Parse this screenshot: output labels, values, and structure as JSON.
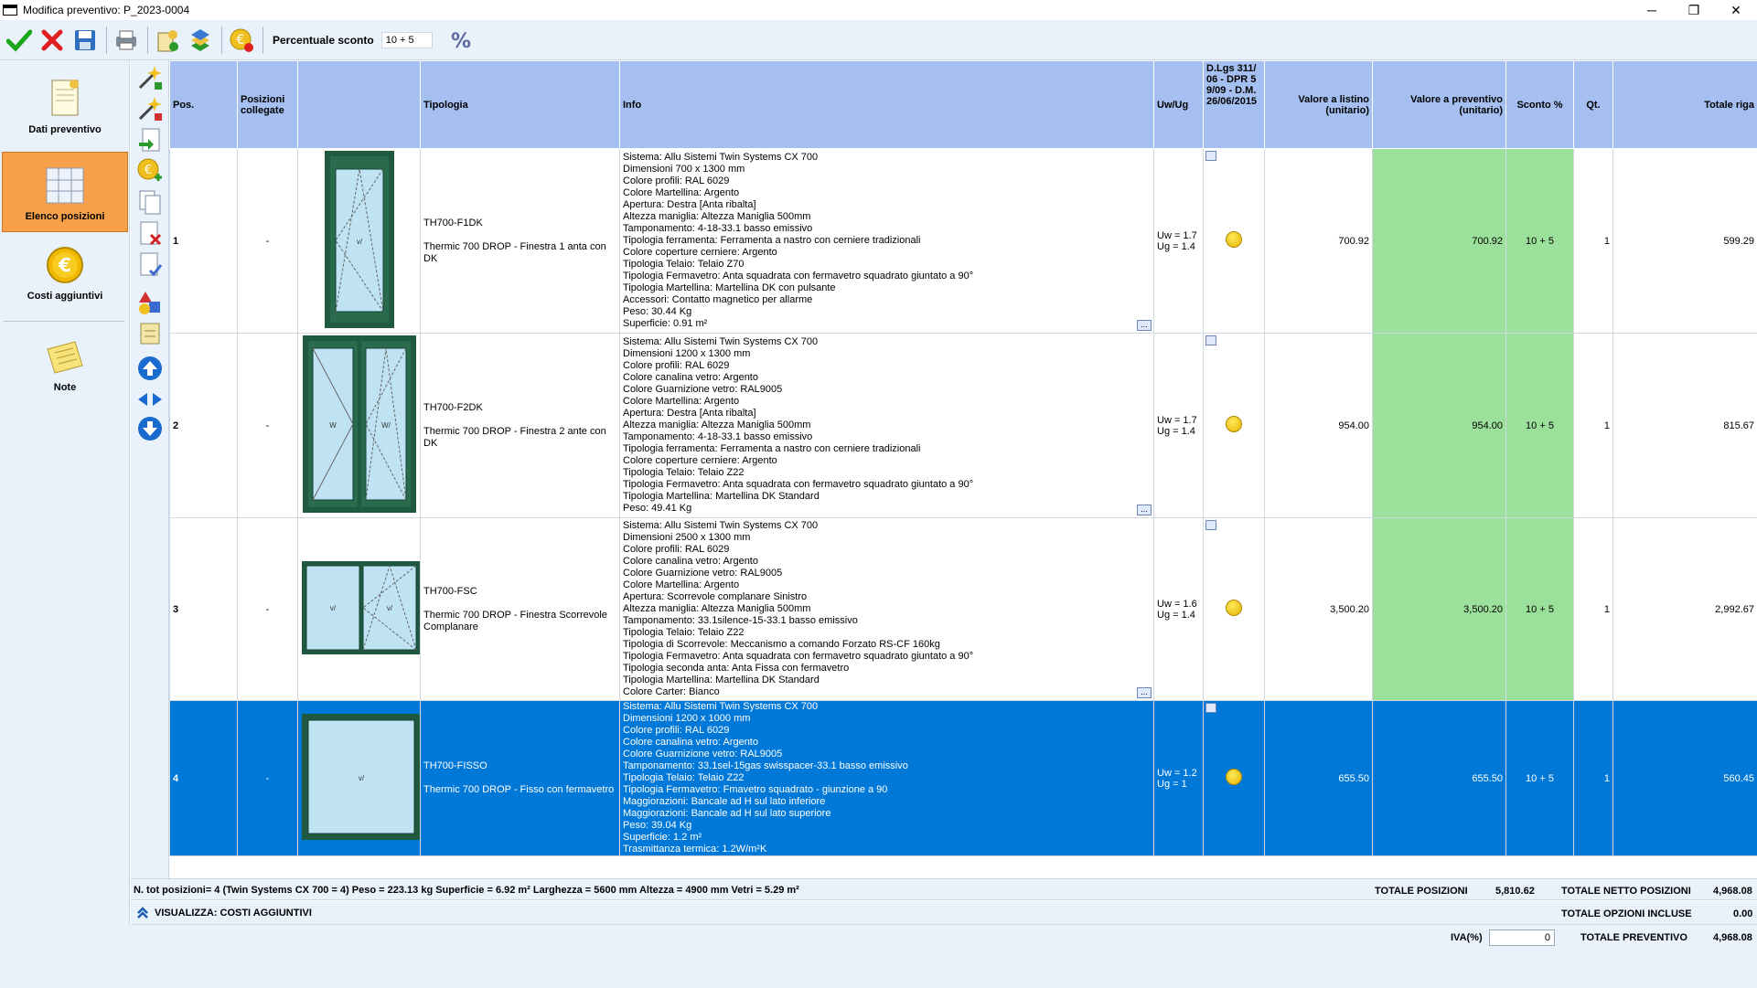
{
  "window": {
    "title": "Modifica preventivo: P_2023-0004",
    "minimize": "─",
    "restore": "❐",
    "close": "✕"
  },
  "toolbar": {
    "discount_label": "Percentuale sconto",
    "discount_value": "10 + 5"
  },
  "nav": {
    "items": [
      {
        "id": "dati",
        "label": "Dati preventivo",
        "icon": "document-icon"
      },
      {
        "id": "elenco",
        "label": "Elenco posizioni",
        "icon": "window-grid-icon"
      },
      {
        "id": "costi",
        "label": "Costi aggiuntivi",
        "icon": "euro-coin-icon"
      },
      {
        "id": "note",
        "label": "Note",
        "icon": "notes-icon"
      }
    ]
  },
  "table": {
    "headers": {
      "pos": "Pos.",
      "linked": "Posizioni collegate",
      "image": "",
      "tipologia": "Tipologia",
      "info": "Info",
      "uwug": "Uw/Ug",
      "dlgs": "D.Lgs 311/06 - DPR 59/09 - D.M. 26/06/2015",
      "listino": "Valore a listino (unitario)",
      "preventivo": "Valore a preventivo (unitario)",
      "sconto": "Sconto %",
      "qt": "Qt.",
      "totale": "Totale riga"
    },
    "rows": [
      {
        "pos": "1",
        "linked": "-",
        "code": "TH700-F1DK",
        "desc": "Thermic 700 DROP - Finestra 1 anta con DK",
        "info": "Sistema: Allu Sistemi Twin Systems CX 700\nDimensioni 700 x 1300  mm\nColore profili: RAL 6029\nColore Martellina: Argento\nApertura: Destra [Anta ribalta]\nAltezza maniglia: Altezza Maniglia 500mm\nTamponamento: 4-18-33.1 basso emissivo\nTipologia ferramenta: Ferramenta a nastro con cerniere tradizionali\nColore coperture cerniere: Argento\nTipologia Telaio: Telaio Z70\nTipologia Fermavetro: Anta squadrata con fermavetro squadrato giuntato a 90°\nTipologia Martellina: Martellina DK con pulsante\nAccessori: Contatto magnetico per allarme\nPeso: 30.44 Kg\nSuperficie: 0.91 m²",
        "uw": "Uw = 1.7",
        "ug": "Ug = 1.4",
        "listino": "700.92",
        "preventivo": "700.92",
        "sconto": "10 + 5",
        "qt": "1",
        "totale": "599.29"
      },
      {
        "pos": "2",
        "linked": "-",
        "code": "TH700-F2DK",
        "desc": "Thermic 700 DROP - Finestra 2 ante con DK",
        "info": "Sistema: Allu Sistemi Twin Systems CX 700\nDimensioni 1200 x 1300  mm\nColore profili: RAL 6029\nColore canalina vetro: Argento\nColore Guarnizione vetro: RAL9005\nColore Martellina: Argento\nApertura: Destra [Anta ribalta]\nAltezza maniglia: Altezza Maniglia 500mm\nTamponamento: 4-18-33.1 basso emissivo\nTipologia ferramenta: Ferramenta a nastro con cerniere tradizionali\nColore coperture cerniere: Argento\nTipologia Telaio: Telaio Z22\nTipologia Fermavetro: Anta squadrata con fermavetro squadrato giuntato a 90°\nTipologia Martellina: Martellina DK Standard\nPeso: 49.41 Kg",
        "uw": "Uw = 1.7",
        "ug": "Ug = 1.4",
        "listino": "954.00",
        "preventivo": "954.00",
        "sconto": "10 + 5",
        "qt": "1",
        "totale": "815.67"
      },
      {
        "pos": "3",
        "linked": "-",
        "code": "TH700-FSC",
        "desc": "Thermic 700 DROP - Finestra Scorrevole Complanare",
        "info": "Sistema: Allu Sistemi Twin Systems CX 700\nDimensioni 2500 x 1300  mm\nColore profili: RAL 6029\nColore canalina vetro: Argento\nColore Guarnizione vetro: RAL9005\nColore Martellina: Argento\nApertura: Scorrevole complanare Sinistro\nAltezza maniglia: Altezza Maniglia 500mm\nTamponamento: 33.1silence-15-33.1 basso emissivo\nTipologia Telaio: Telaio Z22\nTipologia di Scorrevole: Meccanismo a comando Forzato RS-CF 160kg\nTipologia Fermavetro: Anta squadrata con fermavetro squadrato giuntato a 90°\nTipologia seconda anta: Anta Fissa con fermavetro\nTipologia Martellina: Martellina DK Standard\nColore Carter: Bianco",
        "uw": "Uw = 1.6",
        "ug": "Ug = 1.4",
        "listino": "3,500.20",
        "preventivo": "3,500.20",
        "sconto": "10 + 5",
        "qt": "1",
        "totale": "2,992.67"
      },
      {
        "pos": "4",
        "linked": "-",
        "code": "TH700-FISSO",
        "desc": "Thermic 700 DROP - Fisso con fermavetro",
        "info": "Sistema: Allu Sistemi Twin Systems CX 700\nDimensioni 1200 x 1000  mm\nColore profili: RAL 6029\nColore canalina vetro: Argento\nColore Guarnizione vetro: RAL9005\nTamponamento: 33.1sel-15gas swisspacer-33.1 basso emissivo\nTipologia Telaio: Telaio Z22\nTipologia Fermavetro: Fmavetro squadrato - giunzione a 90\nMaggiorazioni: Bancale ad H sul lato inferiore\nMaggiorazioni: Bancale ad H sul lato superiore\nPeso: 39.04 Kg\nSuperficie: 1.2 m²\nTrasmittanza termica: 1.2W/m²K",
        "uw": "Uw = 1.2",
        "ug": "Ug = 1",
        "listino": "655.50",
        "preventivo": "655.50",
        "sconto": "10 + 5",
        "qt": "1",
        "totale": "560.45"
      }
    ],
    "sash_labels": {
      "single": "v/",
      "double_left": "W",
      "double_right": "W/"
    }
  },
  "summary": {
    "stats": "N. tot posizioni= 4 (Twin Systems CX 700 = 4)  Peso = 223.13 kg  Superficie = 6.92 m²  Larghezza = 5600 mm  Altezza = 4900 mm  Vetri = 5.29 m²",
    "totale_posizioni_label": "TOTALE POSIZIONI",
    "totale_posizioni": "5,810.62",
    "totale_netto_label": "TOTALE NETTO POSIZIONI",
    "totale_netto": "4,968.08",
    "visualizza": "VISUALIZZA: COSTI AGGIUNTIVI",
    "opzioni_label": "TOTALE OPZIONI INCLUSE",
    "opzioni": "0.00",
    "iva_label": "IVA(%)",
    "iva_value": "0",
    "totale_preventivo_label": "TOTALE PREVENTIVO",
    "totale_preventivo": "4,968.08"
  },
  "colors": {
    "header": "#a4bff0",
    "selected": "#0078d7",
    "green": "#9be09b",
    "frame": "#1f5a40",
    "nav_active": "#f6a14a"
  }
}
